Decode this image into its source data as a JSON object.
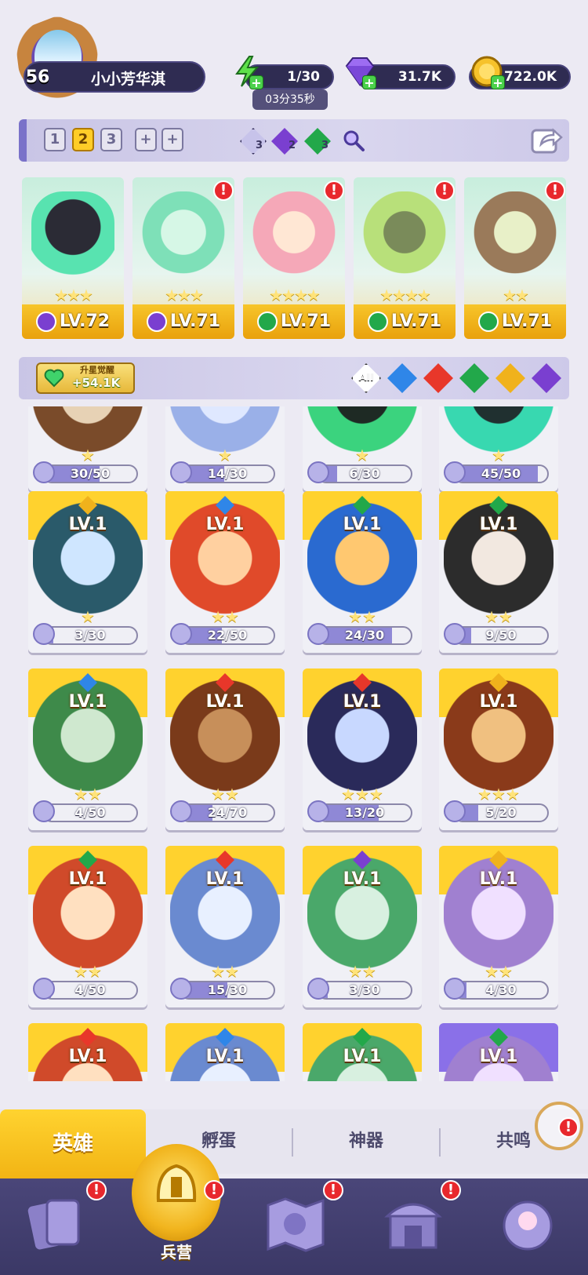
{
  "player": {
    "level": "56",
    "name": "小小芳华淇"
  },
  "resources": {
    "energy": "1/30",
    "energy_timer": "03分35秒",
    "gems": "31.7K",
    "gold": "722.0K"
  },
  "team": {
    "tabs": [
      "1",
      "2",
      "3",
      "+",
      "+"
    ],
    "active_tab": "2",
    "faction_counts": [
      {
        "icon": "light-faction-icon",
        "count": "3"
      },
      {
        "icon": "dark-faction-icon",
        "count": "2"
      },
      {
        "icon": "nature-faction-icon",
        "count": "3"
      }
    ],
    "members": [
      {
        "level": "LV.72",
        "stars": "★★★",
        "element": "dark",
        "alert": false
      },
      {
        "level": "LV.71",
        "stars": "★★★",
        "element": "dark",
        "alert": true
      },
      {
        "level": "LV.71",
        "stars": "★★★★",
        "element": "nature",
        "alert": true
      },
      {
        "level": "LV.71",
        "stars": "★★★★",
        "element": "nature",
        "alert": true
      },
      {
        "level": "LV.71",
        "stars": "★★",
        "element": "nature",
        "alert": true
      }
    ]
  },
  "filter": {
    "awaken_label": "升星觉醒",
    "awaken_value": "+54.1K",
    "all_label": "All",
    "elements": [
      "water",
      "fire",
      "nature",
      "light",
      "dark"
    ]
  },
  "heroes": [
    {
      "level": "",
      "element": "",
      "stars": "★",
      "fragments": "30/50",
      "progress": 0.6,
      "partial": true
    },
    {
      "level": "",
      "element": "",
      "stars": "★",
      "fragments": "14/30",
      "progress": 0.47,
      "partial": true
    },
    {
      "level": "",
      "element": "",
      "stars": "★",
      "fragments": "6/30",
      "progress": 0.2,
      "partial": true
    },
    {
      "level": "",
      "element": "",
      "stars": "★",
      "fragments": "45/50",
      "progress": 0.9,
      "partial": true
    },
    {
      "level": "LV.1",
      "element": "light",
      "stars": "★",
      "fragments": "3/30",
      "progress": 0.1
    },
    {
      "level": "LV.1",
      "element": "water",
      "stars": "★★",
      "fragments": "22/50",
      "progress": 0.44
    },
    {
      "level": "LV.1",
      "element": "nature",
      "stars": "★★",
      "fragments": "24/30",
      "progress": 0.8
    },
    {
      "level": "LV.1",
      "element": "nature",
      "stars": "★★",
      "fragments": "9/50",
      "progress": 0.18
    },
    {
      "level": "LV.1",
      "element": "water",
      "stars": "★★",
      "fragments": "4/50",
      "progress": 0.08
    },
    {
      "level": "LV.1",
      "element": "fire",
      "stars": "★★",
      "fragments": "24/70",
      "progress": 0.34
    },
    {
      "level": "LV.1",
      "element": "fire",
      "stars": "★★★",
      "fragments": "13/20",
      "progress": 0.65
    },
    {
      "level": "LV.1",
      "element": "light",
      "stars": "★★★",
      "fragments": "5/20",
      "progress": 0.25
    },
    {
      "level": "LV.1",
      "element": "nature",
      "stars": "★★",
      "fragments": "4/50",
      "progress": 0.08
    },
    {
      "level": "LV.1",
      "element": "fire",
      "stars": "★★",
      "fragments": "15/30",
      "progress": 0.5
    },
    {
      "level": "LV.1",
      "element": "dark",
      "stars": "★★",
      "fragments": "3/30",
      "progress": 0.1
    },
    {
      "level": "LV.1",
      "element": "light",
      "stars": "★★",
      "fragments": "4/30",
      "progress": 0.13
    },
    {
      "level": "LV.1",
      "element": "fire",
      "stars": "",
      "fragments": "",
      "progress": 0
    },
    {
      "level": "LV.1",
      "element": "water",
      "stars": "",
      "fragments": "",
      "progress": 0
    },
    {
      "level": "LV.1",
      "element": "nature",
      "stars": "",
      "fragments": "",
      "progress": 0
    },
    {
      "level": "LV.1",
      "element": "nature",
      "stars": "",
      "fragments": "",
      "progress": 0,
      "rarity": "purple"
    }
  ],
  "subtabs": {
    "hero": "英雄",
    "hatch": "孵蛋",
    "artifact": "神器",
    "resonance": "共鸣"
  },
  "nav": {
    "barracks": "兵营",
    "alert": "!"
  },
  "colors": {
    "water": "#2f86e8",
    "fire": "#e8372a",
    "nature": "#22a84a",
    "light": "#f0b21c",
    "dark": "#7a3fd0",
    "accent_gold": "#ffd330",
    "panel_dark": "#2f2c52"
  }
}
